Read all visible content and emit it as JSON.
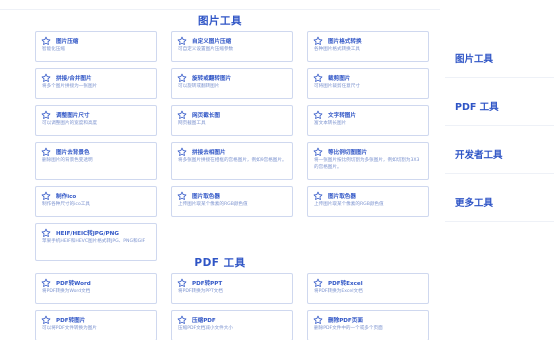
{
  "sections": [
    {
      "title": "图片工具",
      "tools": [
        {
          "name": "图片压缩",
          "desc": "智能化压缩"
        },
        {
          "name": "自定义图片压缩",
          "desc": "可自定义设置图片压缩参数"
        },
        {
          "name": "图片格式转换",
          "desc": "各种图片格式转换工具"
        },
        {
          "name": "拼接/合并图片",
          "desc": "将多个图片拼接为一张图片"
        },
        {
          "name": "旋转或翻转图片",
          "desc": "可以旋转或翻转图片"
        },
        {
          "name": "裁剪图片",
          "desc": "可将图片裁剪任意尺寸"
        },
        {
          "name": "调整图片尺寸",
          "desc": "可以调整图片的宽度和高度"
        },
        {
          "name": "网页截长图",
          "desc": "网页截图工具"
        },
        {
          "name": "文字转图片",
          "desc": "富文本转长图片"
        },
        {
          "name": "图片去背景色",
          "desc": "删除图片的背景色变透明"
        },
        {
          "name": "拼接去相图片",
          "desc": "将多张图片拼接在相框的宫格图片，例如9宫格图片。"
        },
        {
          "name": "等比例切图图片",
          "desc": "将一张图片按比例切割为多张图片，例如切割为3X3的宫格图片。"
        },
        {
          "name": "制作ico",
          "desc": "制作各种尺寸的ico工具"
        },
        {
          "name": "图片取色器",
          "desc": "上传图片取某个像素的RGB颜色值"
        },
        {
          "name": "图片取色器",
          "desc": "上传图片取某个像素的RGB颜色值"
        },
        {
          "name": "HEIF/HEIC转JPG/PNG",
          "desc": "苹果手机HEIF和HEVC图片格式转JPG、PNG和GIF"
        }
      ]
    },
    {
      "title": "PDF 工具",
      "tools": [
        {
          "name": "PDF转Word",
          "desc": "将PDF转换为Word文档"
        },
        {
          "name": "PDF转PPT",
          "desc": "将PDF转换为PPT文档"
        },
        {
          "name": "PDF转Excel",
          "desc": "将PDF转换为Excel文档"
        },
        {
          "name": "PDF转图片",
          "desc": "可以将PDF文件转换为图片"
        },
        {
          "name": "压缩PDF",
          "desc": "压缩PDF文档减小文件大小"
        },
        {
          "name": "删除PDF页面",
          "desc": "删除PDF文件中的一个或多个页面"
        }
      ]
    }
  ],
  "sidebar": {
    "items": [
      {
        "label": "图片工具"
      },
      {
        "label": "PDF 工具"
      },
      {
        "label": "开发者工具"
      },
      {
        "label": "更多工具"
      }
    ]
  },
  "colors": {
    "accent": "#2f55c6",
    "card_border": "#cfd8ef",
    "desc": "#7c93cf"
  },
  "icons": {
    "card": "star-outline-icon"
  }
}
